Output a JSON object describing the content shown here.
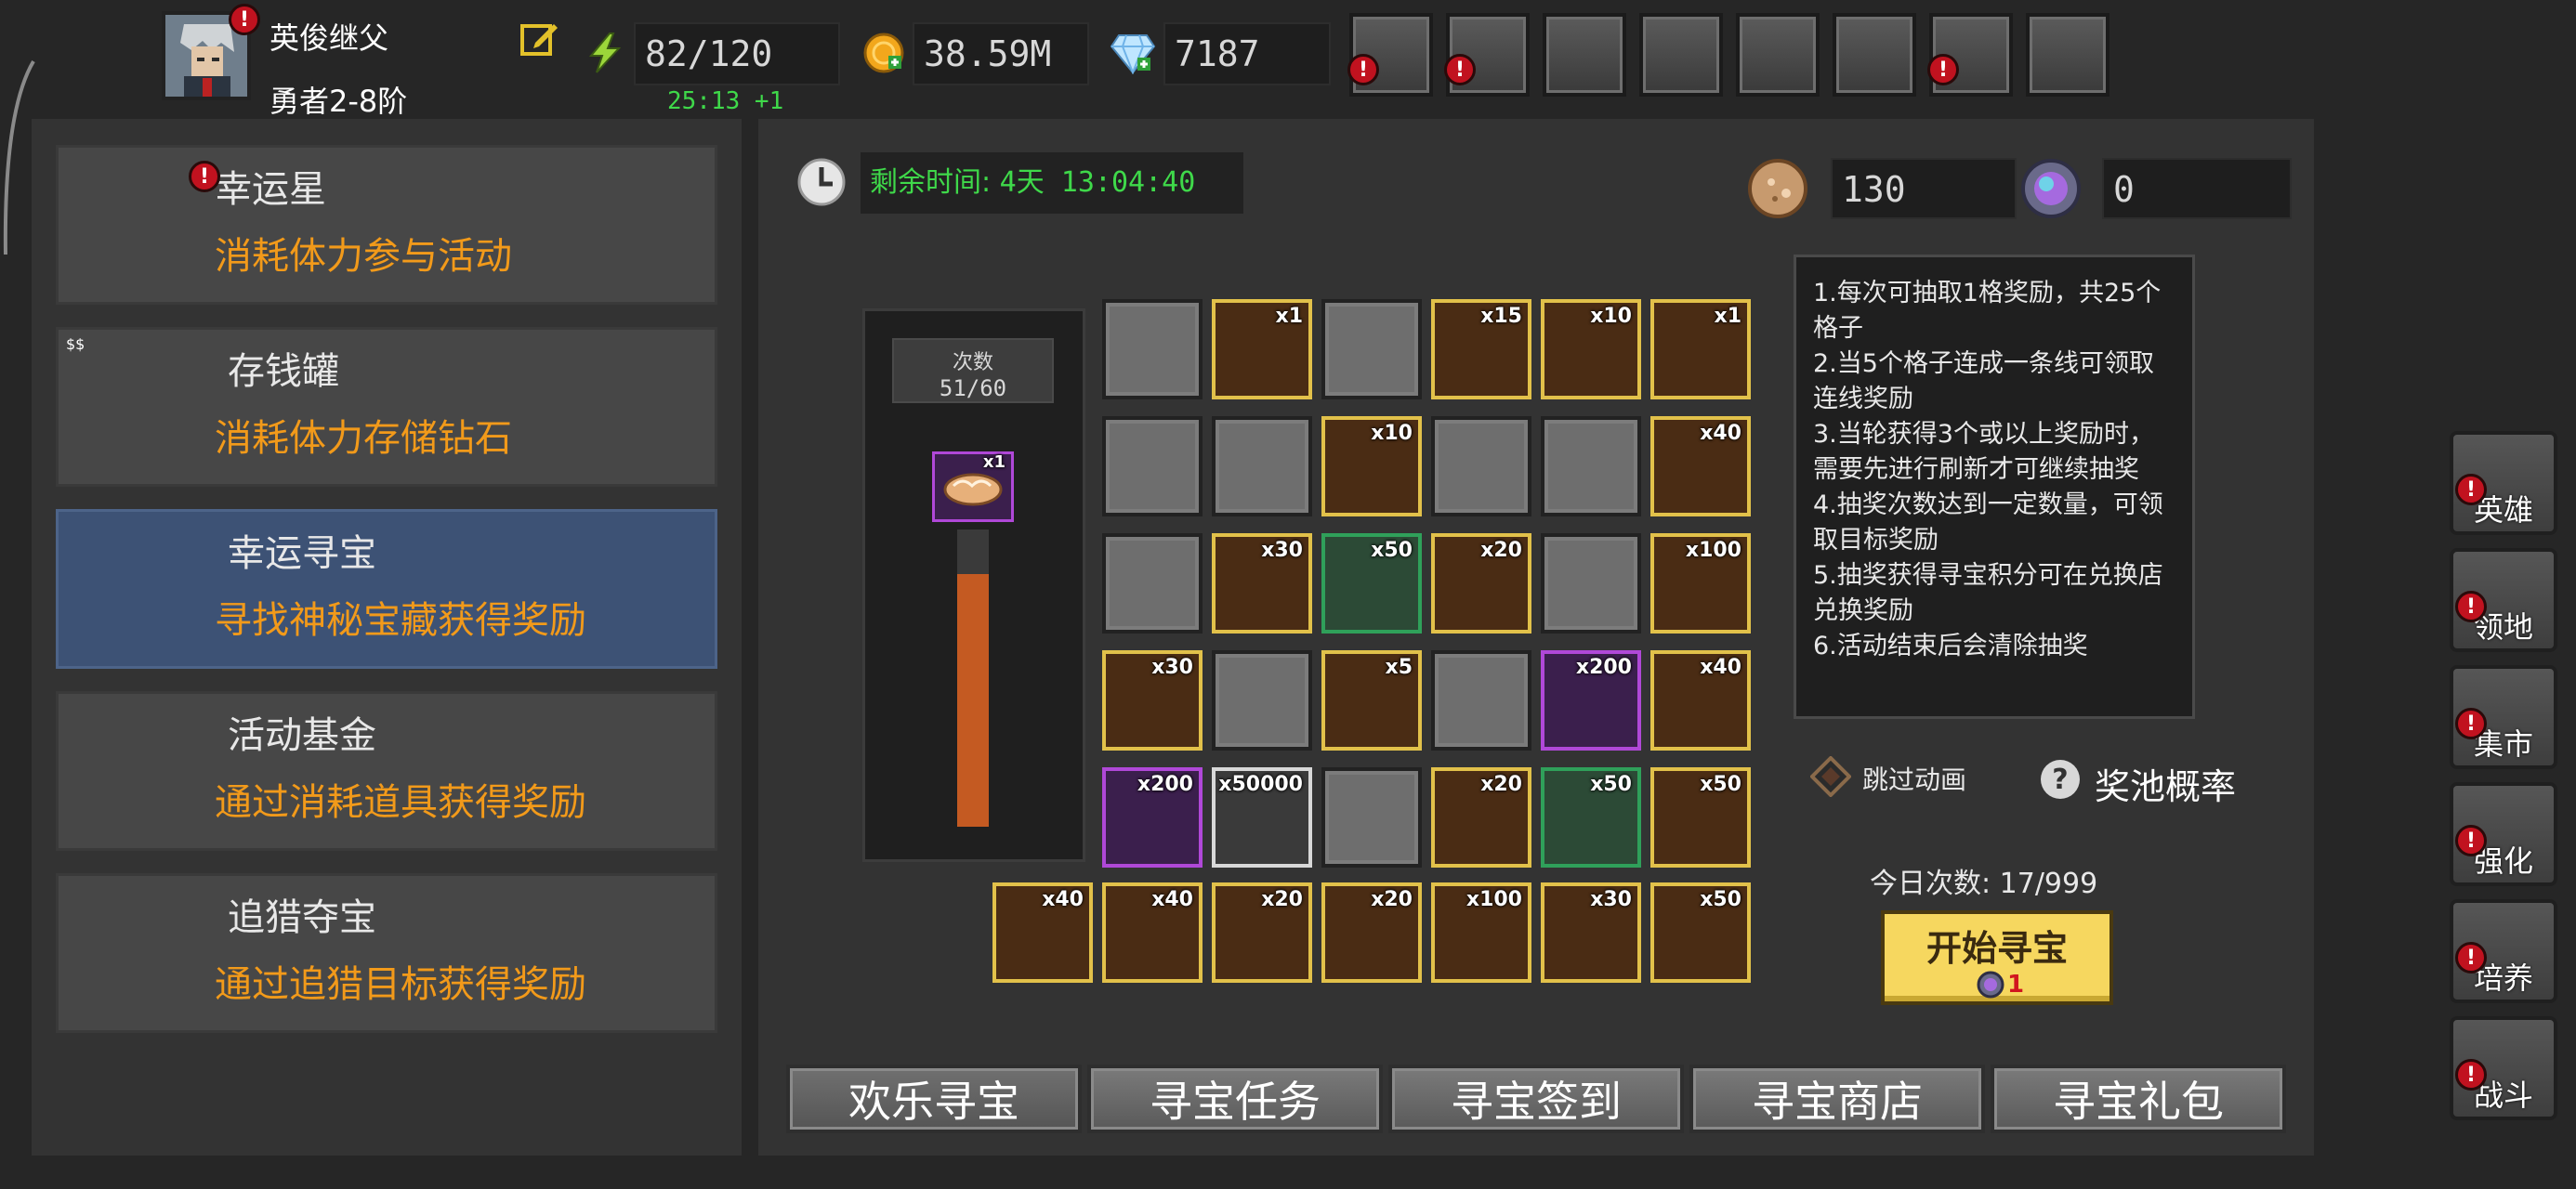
{
  "player": {
    "name": "英俊继父",
    "rank": "勇者2-8阶",
    "avatar_icon": "knight-portrait-icon"
  },
  "resources": {
    "stamina": "82/120",
    "stamina_timer": "25:13 +1",
    "gold": "38.59M",
    "diamonds": "7187"
  },
  "top_buttons": [
    {
      "icon": "shop-cart-icon",
      "alert": true
    },
    {
      "icon": "mail-icon",
      "alert": true
    },
    {
      "icon": "gamepad-icon",
      "alert": false
    },
    {
      "icon": "settings-gear-icon",
      "alert": false
    },
    {
      "icon": "gift-box-icon",
      "alert": false
    },
    {
      "icon": "color-wheel-icon",
      "alert": false
    },
    {
      "icon": "fireworks-icon",
      "alert": true
    },
    {
      "icon": "crossed-swords-icon",
      "alert": false
    }
  ],
  "menu": [
    {
      "title": "幸运星",
      "desc": "消耗体力参与活动",
      "icon": "lucky-star-icon",
      "alert": true,
      "active": false
    },
    {
      "title": "存钱罐",
      "desc": "消耗体力存储钻石",
      "icon": "piggy-bank-icon",
      "alert": false,
      "active": false
    },
    {
      "title": "幸运寻宝",
      "desc": "寻找神秘宝藏获得奖励",
      "icon": "treasure-medallion-icon",
      "alert": false,
      "active": true
    },
    {
      "title": "活动基金",
      "desc": "通过消耗道具获得奖励",
      "icon": "money-bag-icon",
      "alert": false,
      "active": false
    },
    {
      "title": "追猎夺宝",
      "desc": "通过追猎目标获得奖励",
      "icon": "treasure-chest-icon",
      "alert": false,
      "active": false
    }
  ],
  "event": {
    "time_label": "剩余时间:",
    "time_value": "4天 13:04:40",
    "currency1_value": "130",
    "currency2_value": "0",
    "count_label": "次数",
    "count_value": "51/60",
    "progress_fraction": 0.85,
    "progress_reward_qty": "x1",
    "rules": "1.每次可抽取1格奖励，共25个格子\n2.当5个格子连成一条线可领取连线奖励\n3.当轮获得3个或以上奖励时，需要先进行刷新才可继续抽奖\n4.抽奖次数达到一定数量，可领取目标奖励\n5.抽奖获得寻宝积分可在兑换店兑换奖励\n6.活动结束后会清除抽奖",
    "skip_animation": "跳过动画",
    "pool_rate": "奖池概率",
    "today_count": "今日次数: 17/999",
    "start_button": "开始寻宝",
    "start_cost": "1"
  },
  "grid": [
    [
      {
        "t": "empty"
      },
      {
        "t": "item",
        "icon": "purple-orb-icon",
        "q": "x1"
      },
      {
        "t": "empty"
      },
      {
        "t": "item",
        "icon": "stone-orb-icon",
        "q": "x15"
      },
      {
        "t": "item",
        "icon": "stone-orb-icon",
        "q": "x10"
      },
      {
        "t": "item",
        "icon": "purple-orb-icon",
        "q": "x1",
        "lock": true
      }
    ],
    [
      {
        "t": "empty"
      },
      {
        "t": "empty"
      },
      {
        "t": "item",
        "icon": "stone-orb-icon",
        "q": "x10"
      },
      {
        "t": "empty"
      },
      {
        "t": "empty"
      },
      {
        "t": "item",
        "icon": "mace-icon",
        "q": "x40",
        "lock": true
      }
    ],
    [
      {
        "t": "empty"
      },
      {
        "t": "item",
        "icon": "mace-icon",
        "q": "x30"
      },
      {
        "t": "green",
        "icon": "bone-icon",
        "q": "x50"
      },
      {
        "t": "item",
        "icon": "mace-icon",
        "q": "x20"
      },
      {
        "t": "empty"
      },
      {
        "t": "item",
        "icon": "diamond-icon",
        "q": "x100",
        "lock": true
      }
    ],
    [
      {
        "t": "item",
        "icon": "mace-icon",
        "q": "x30"
      },
      {
        "t": "empty"
      },
      {
        "t": "item",
        "icon": "egg-icon",
        "q": "x5"
      },
      {
        "t": "empty"
      },
      {
        "t": "purple",
        "icon": "fire-crystal-icon",
        "q": "x200"
      },
      {
        "t": "item",
        "icon": "mace-icon",
        "q": "x40",
        "lock": true
      }
    ],
    [
      {
        "t": "purple",
        "icon": "fire-crystal-icon",
        "q": "x200"
      },
      {
        "t": "white",
        "icon": "gold-coin-icon",
        "q": "x50000"
      },
      {
        "t": "empty"
      },
      {
        "t": "item",
        "icon": "lightning-icon",
        "q": "x20"
      },
      {
        "t": "green",
        "icon": "bone-icon",
        "q": "x50"
      },
      {
        "t": "item",
        "icon": "stone-orb-icon",
        "q": "x50",
        "lock": true
      }
    ]
  ],
  "line_rewards": [
    {
      "icon": "mace-icon",
      "q": "x40"
    },
    {
      "icon": "mace-icon",
      "q": "x40"
    },
    {
      "icon": "blue-ore-icon",
      "q": "x20"
    },
    {
      "icon": "blue-ore-icon",
      "q": "x20"
    },
    {
      "icon": "diamond-icon",
      "q": "x100"
    },
    {
      "icon": "egg-icon",
      "q": "x30"
    },
    {
      "icon": "stone-orb-icon",
      "q": "x50"
    }
  ],
  "tabs": [
    "欢乐寻宝",
    "寻宝任务",
    "寻宝签到",
    "寻宝商店",
    "寻宝礼包"
  ],
  "side_buttons": [
    {
      "label": "英雄",
      "icon": "hero-helmet-icon"
    },
    {
      "label": "领地",
      "icon": "castle-icon"
    },
    {
      "label": "集市",
      "icon": "market-stall-icon"
    },
    {
      "label": "强化",
      "icon": "enhance-crystal-icon"
    },
    {
      "label": "培养",
      "icon": "chalice-icon"
    },
    {
      "label": "战斗",
      "icon": "battle-portal-icon"
    }
  ]
}
